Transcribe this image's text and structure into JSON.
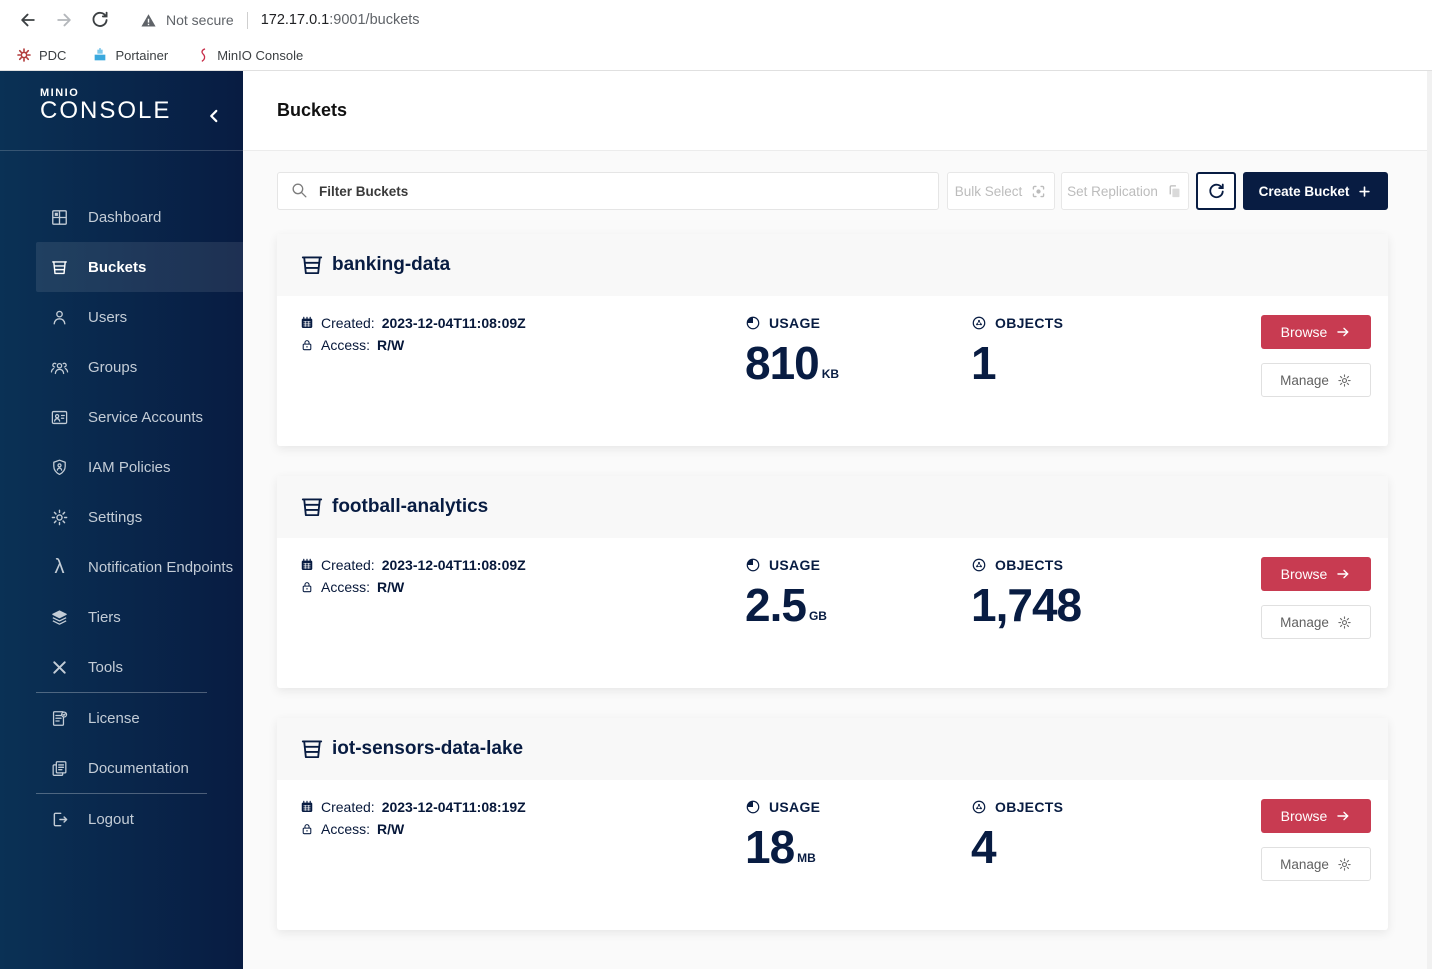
{
  "browser": {
    "security_label": "Not secure",
    "url_host": "172.17.0.1",
    "url_path": ":9001/buckets",
    "bookmarks": [
      {
        "label": "PDC"
      },
      {
        "label": "Portainer"
      },
      {
        "label": "MinIO Console"
      }
    ]
  },
  "sidebar": {
    "logo_small": "MINIO",
    "logo_large": "CONSOLE",
    "items": [
      {
        "label": "Dashboard"
      },
      {
        "label": "Buckets"
      },
      {
        "label": "Users"
      },
      {
        "label": "Groups"
      },
      {
        "label": "Service Accounts"
      },
      {
        "label": "IAM Policies"
      },
      {
        "label": "Settings"
      },
      {
        "label": "Notification Endpoints"
      },
      {
        "label": "Tiers"
      },
      {
        "label": "Tools"
      },
      {
        "label": "License"
      },
      {
        "label": "Documentation"
      },
      {
        "label": "Logout"
      }
    ]
  },
  "page": {
    "title": "Buckets"
  },
  "toolbar": {
    "filter_placeholder": "Filter Buckets",
    "bulk_select_label": "Bulk Select",
    "set_replication_label": "Set Replication",
    "create_bucket_label": "Create Bucket"
  },
  "labels": {
    "created": "Created:",
    "access": "Access:",
    "usage": "USAGE",
    "objects": "OBJECTS",
    "browse": "Browse",
    "manage": "Manage"
  },
  "buckets": [
    {
      "name": "banking-data",
      "created": "2023-12-04T11:08:09Z",
      "access": "R/W",
      "usage_value": "810",
      "usage_unit": "KB",
      "objects": "1"
    },
    {
      "name": "football-analytics",
      "created": "2023-12-04T11:08:09Z",
      "access": "R/W",
      "usage_value": "2.5",
      "usage_unit": "GB",
      "objects": "1,748"
    },
    {
      "name": "iot-sensors-data-lake",
      "created": "2023-12-04T11:08:19Z",
      "access": "R/W",
      "usage_value": "18",
      "usage_unit": "MB",
      "objects": "4"
    }
  ],
  "colors": {
    "navy": "#081C42",
    "red": "#C83B51",
    "sidebar_gradient_start": "#0A3155",
    "sidebar_gradient_end": "#081C42"
  }
}
